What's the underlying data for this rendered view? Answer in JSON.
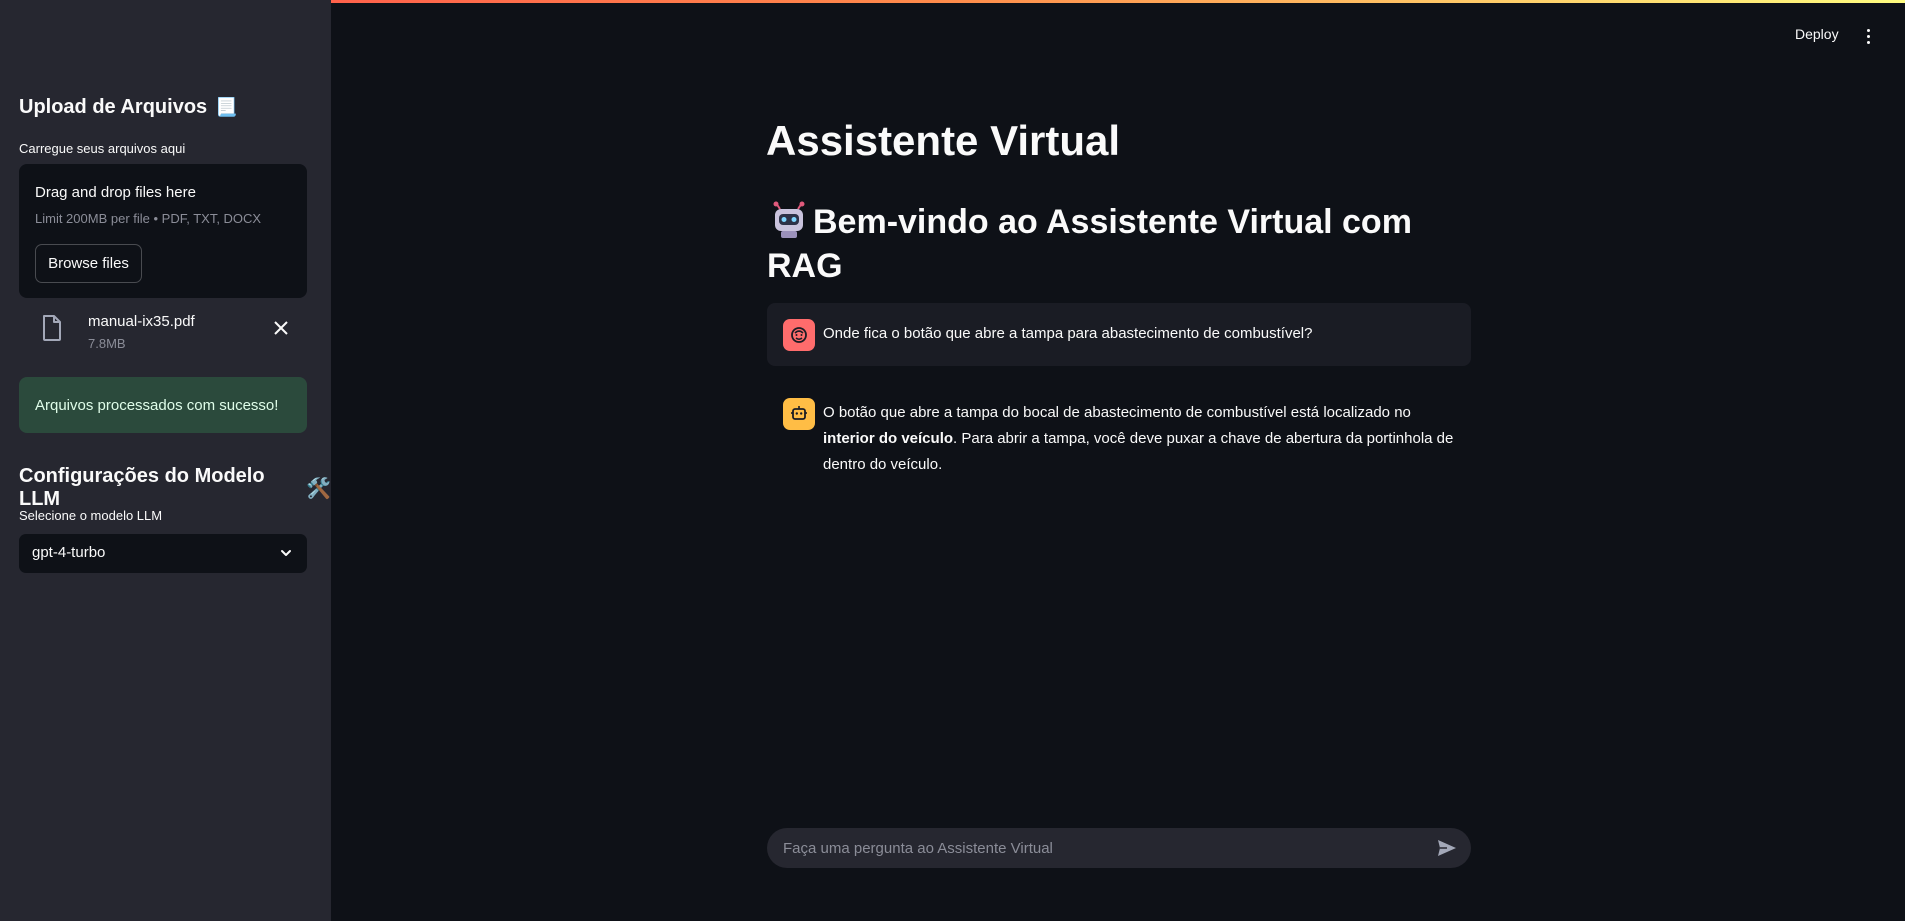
{
  "sidebar": {
    "upload_title": "Upload de Arquivos",
    "upload_emoji": "📃",
    "upload_label": "Carregue seus arquivos aqui",
    "dropzone": {
      "title": "Drag and drop files here",
      "hint": "Limit 200MB per file • PDF, TXT, DOCX",
      "browse_label": "Browse files"
    },
    "file": {
      "name": "manual-ix35.pdf",
      "size": "7.8MB"
    },
    "success_message": "Arquivos processados com sucesso!",
    "config_title": "Configurações do Modelo LLM",
    "config_emoji": "🛠️",
    "model_label": "Selecione o modelo LLM",
    "model_selected": "gpt-4-turbo"
  },
  "header": {
    "deploy_label": "Deploy"
  },
  "main": {
    "title": "Assistente Virtual",
    "welcome": "Bem-vindo ao Assistente Virtual com RAG",
    "messages": {
      "user": "Onde fica o botão que abre a tampa para abastecimento de combustível?",
      "bot_part1": "O botão que abre a tampa do bocal de abastecimento de combustível está localizado no ",
      "bot_bold": "interior do veículo",
      "bot_part2": ". Para abrir a tampa, você deve puxar a chave de abertura da portinhola de dentro do veículo."
    },
    "chat_placeholder": "Faça uma pergunta ao Assistente Virtual"
  },
  "colors": {
    "sidebar_bg": "#262730",
    "main_bg": "#0e1117",
    "success_bg": "#2b4a3c",
    "user_avatar": "#ff6c6c",
    "bot_avatar": "#ffbd45"
  }
}
